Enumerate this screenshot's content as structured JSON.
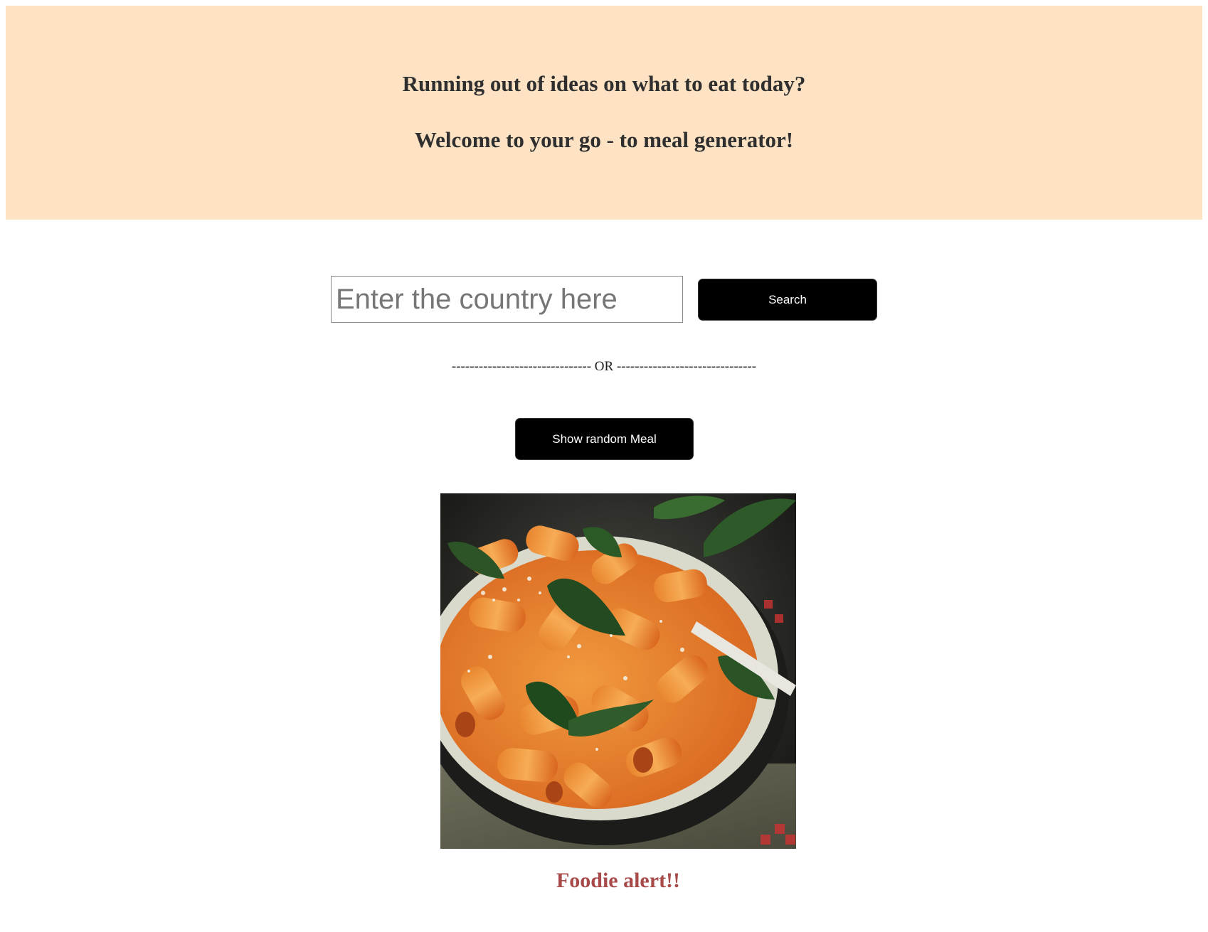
{
  "header": {
    "line1": "Running out of ideas on what to eat today?",
    "line2": "Welcome to your go - to meal generator!",
    "background_color": "#fde3c4"
  },
  "search": {
    "placeholder": "Enter the country here",
    "value": "",
    "button_label": "Search"
  },
  "divider": {
    "text": "------------------------------- OR -------------------------------"
  },
  "random": {
    "button_label": "Show random Meal"
  },
  "meal": {
    "title": "Foodie alert!!",
    "title_color": "#a84a4a"
  }
}
